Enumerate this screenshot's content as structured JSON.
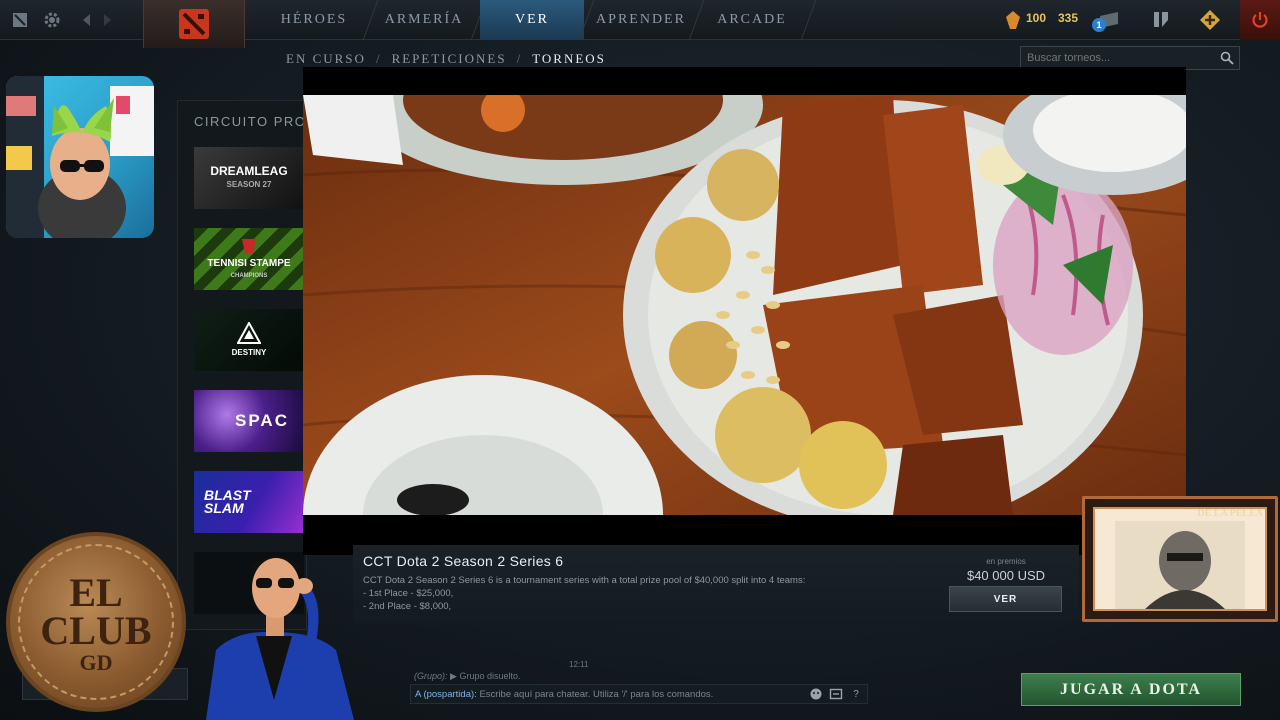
{
  "colors": {
    "accent": "#2b5a7c",
    "gold": "#e6c35a",
    "play_green": "#3d7f4c",
    "power_red": "#b82a1c"
  },
  "topnav": {
    "left_icons": [
      "dota-plus-icon",
      "gear-icon",
      "back-arrow-icon",
      "forward-arrow-icon"
    ],
    "items": [
      {
        "label": "HÉROES",
        "active": false
      },
      {
        "label": "ARMERÍA",
        "active": false
      },
      {
        "label": "VER",
        "active": true
      },
      {
        "label": "APRENDER",
        "active": false
      },
      {
        "label": "ARCADE",
        "active": false
      }
    ],
    "shards": "100",
    "coins": "335",
    "notification_count": "1"
  },
  "subnav": {
    "items": [
      "EN CURSO",
      "REPETICIONES",
      "TORNEOS"
    ],
    "active": "TORNEOS",
    "separator": "/"
  },
  "search": {
    "placeholder": "Buscar torneos..."
  },
  "left_panel": {
    "title": "CIRCUITO PROFE",
    "cards": [
      {
        "label": "DREAMLEAG",
        "sublabel": "SEASON 27"
      },
      {
        "label": "TENNISI STAMPE",
        "sublabel": "CHAMPIONS"
      },
      {
        "label": "DESTINY",
        "sublabel": ""
      },
      {
        "label": "SPAC",
        "sublabel": ""
      },
      {
        "label": "BLAST SLAM",
        "sublabel": ""
      },
      {
        "label": "",
        "sublabel": ""
      }
    ]
  },
  "tournament": {
    "title": "CCT Dota 2 Season 2 Series 6",
    "description": "CCT Dota 2 Season 2 Series 6 is a tournament series with a total prize pool of $40,000 split into 4 teams:",
    "places": [
      "- 1st Place - $25,000,",
      "- 2nd Place - $8,000,"
    ],
    "prize_label": "en premios",
    "prize_amount": "$40 000 USD",
    "view_button": "VER"
  },
  "overlay_card": {
    "title": "DE LA PELEA"
  },
  "club_logo": {
    "line1": "EL",
    "line2": "CLUB",
    "monogram": "GD"
  },
  "chat": {
    "time": "12:11",
    "group_tag": "(Grupo):",
    "group_message": "▶ Grupo disuelto.",
    "input_prefix": "A (pospartida):",
    "input_placeholder": "Escribe aquí para chatear. Utiliza '/' para los comandos.",
    "help": "?"
  },
  "play_button": "JUGAR A DOTA"
}
